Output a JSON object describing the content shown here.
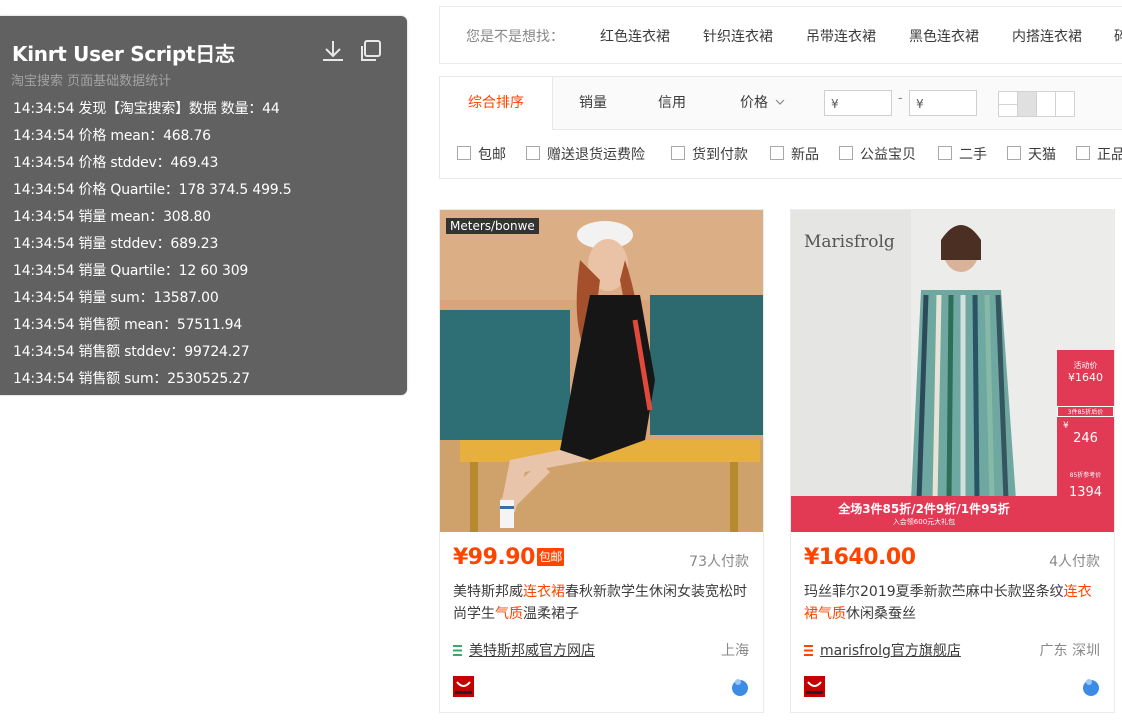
{
  "log_panel": {
    "title": "Kinrt User Script日志",
    "subtitle": "淘宝搜索 页面基础数据统计",
    "lines": [
      "14:34:54 发现【淘宝搜索】数据 数量：44",
      "14:34:54 价格 mean：468.76",
      "14:34:54 价格 stddev：469.43",
      "14:34:54 价格 Quartile：178 374.5 499.5",
      "14:34:54 销量 mean：308.80",
      "14:34:54 销量 stddev：689.23",
      "14:34:54 销量 Quartile：12 60 309",
      "14:34:54 销量 sum：13587.00",
      "14:34:54 销售额 mean：57511.94",
      "14:34:54 销售额 stddev：99724.27",
      "14:34:54 销售额 sum：2530525.27"
    ],
    "icons": [
      "download-icon",
      "copy-icon"
    ]
  },
  "suggest": {
    "label": "您是不是想找：",
    "items": [
      "红色连衣裙",
      "针织连衣裙",
      "吊带连衣裙",
      "黑色连衣裙",
      "内搭连衣裙",
      "碎"
    ]
  },
  "sort": {
    "tabs": [
      "综合排序",
      "销量",
      "信用",
      "价格"
    ],
    "active": "综合排序",
    "price_min_placeholder": "¥",
    "price_max_placeholder": "¥",
    "price_sep": "-"
  },
  "filters": [
    "包邮",
    "赠送退货运费险",
    "货到付款",
    "新品",
    "公益宝贝",
    "二手",
    "天猫",
    "正品"
  ],
  "products": [
    {
      "brand": "Meters/bonwe",
      "price": "¥99.90",
      "badge": "包邮",
      "pay_count": "73人付款",
      "title_parts": [
        "美特斯邦威",
        "连衣裙",
        "春秋新款学生休闲女装宽松时尚学生",
        "气质",
        "温柔裙子"
      ],
      "shop": "美特斯邦威官方网店",
      "location": "上海",
      "shop_icon_color": "#3aa76d"
    },
    {
      "brand": "Marisfrolg",
      "price": "¥1640.00",
      "badge": "",
      "pay_count": "4人付款",
      "title_parts": [
        "玛丝菲尔2019夏季新款苎麻中长款竖条纹",
        "连衣裙",
        "",
        "气质",
        "休闲桑蚕丝"
      ],
      "shop": "marisfrolg官方旗舰店",
      "location": "广东 深圳",
      "shop_icon_color": "#f40",
      "promo": {
        "tag": "活动价",
        "promo_price": "¥1640",
        "promo_small": "3件85折后价",
        "price2_symbol": "¥",
        "price2": "246",
        "ref_label": "85折参考价",
        "ref_price": "1394",
        "banner": "全场3件85折/2件9折/1件95折",
        "banner_sub": "入会领600元大礼包"
      }
    }
  ],
  "colors": {
    "accent": "#ff4400",
    "panel_bg": "#616161"
  }
}
